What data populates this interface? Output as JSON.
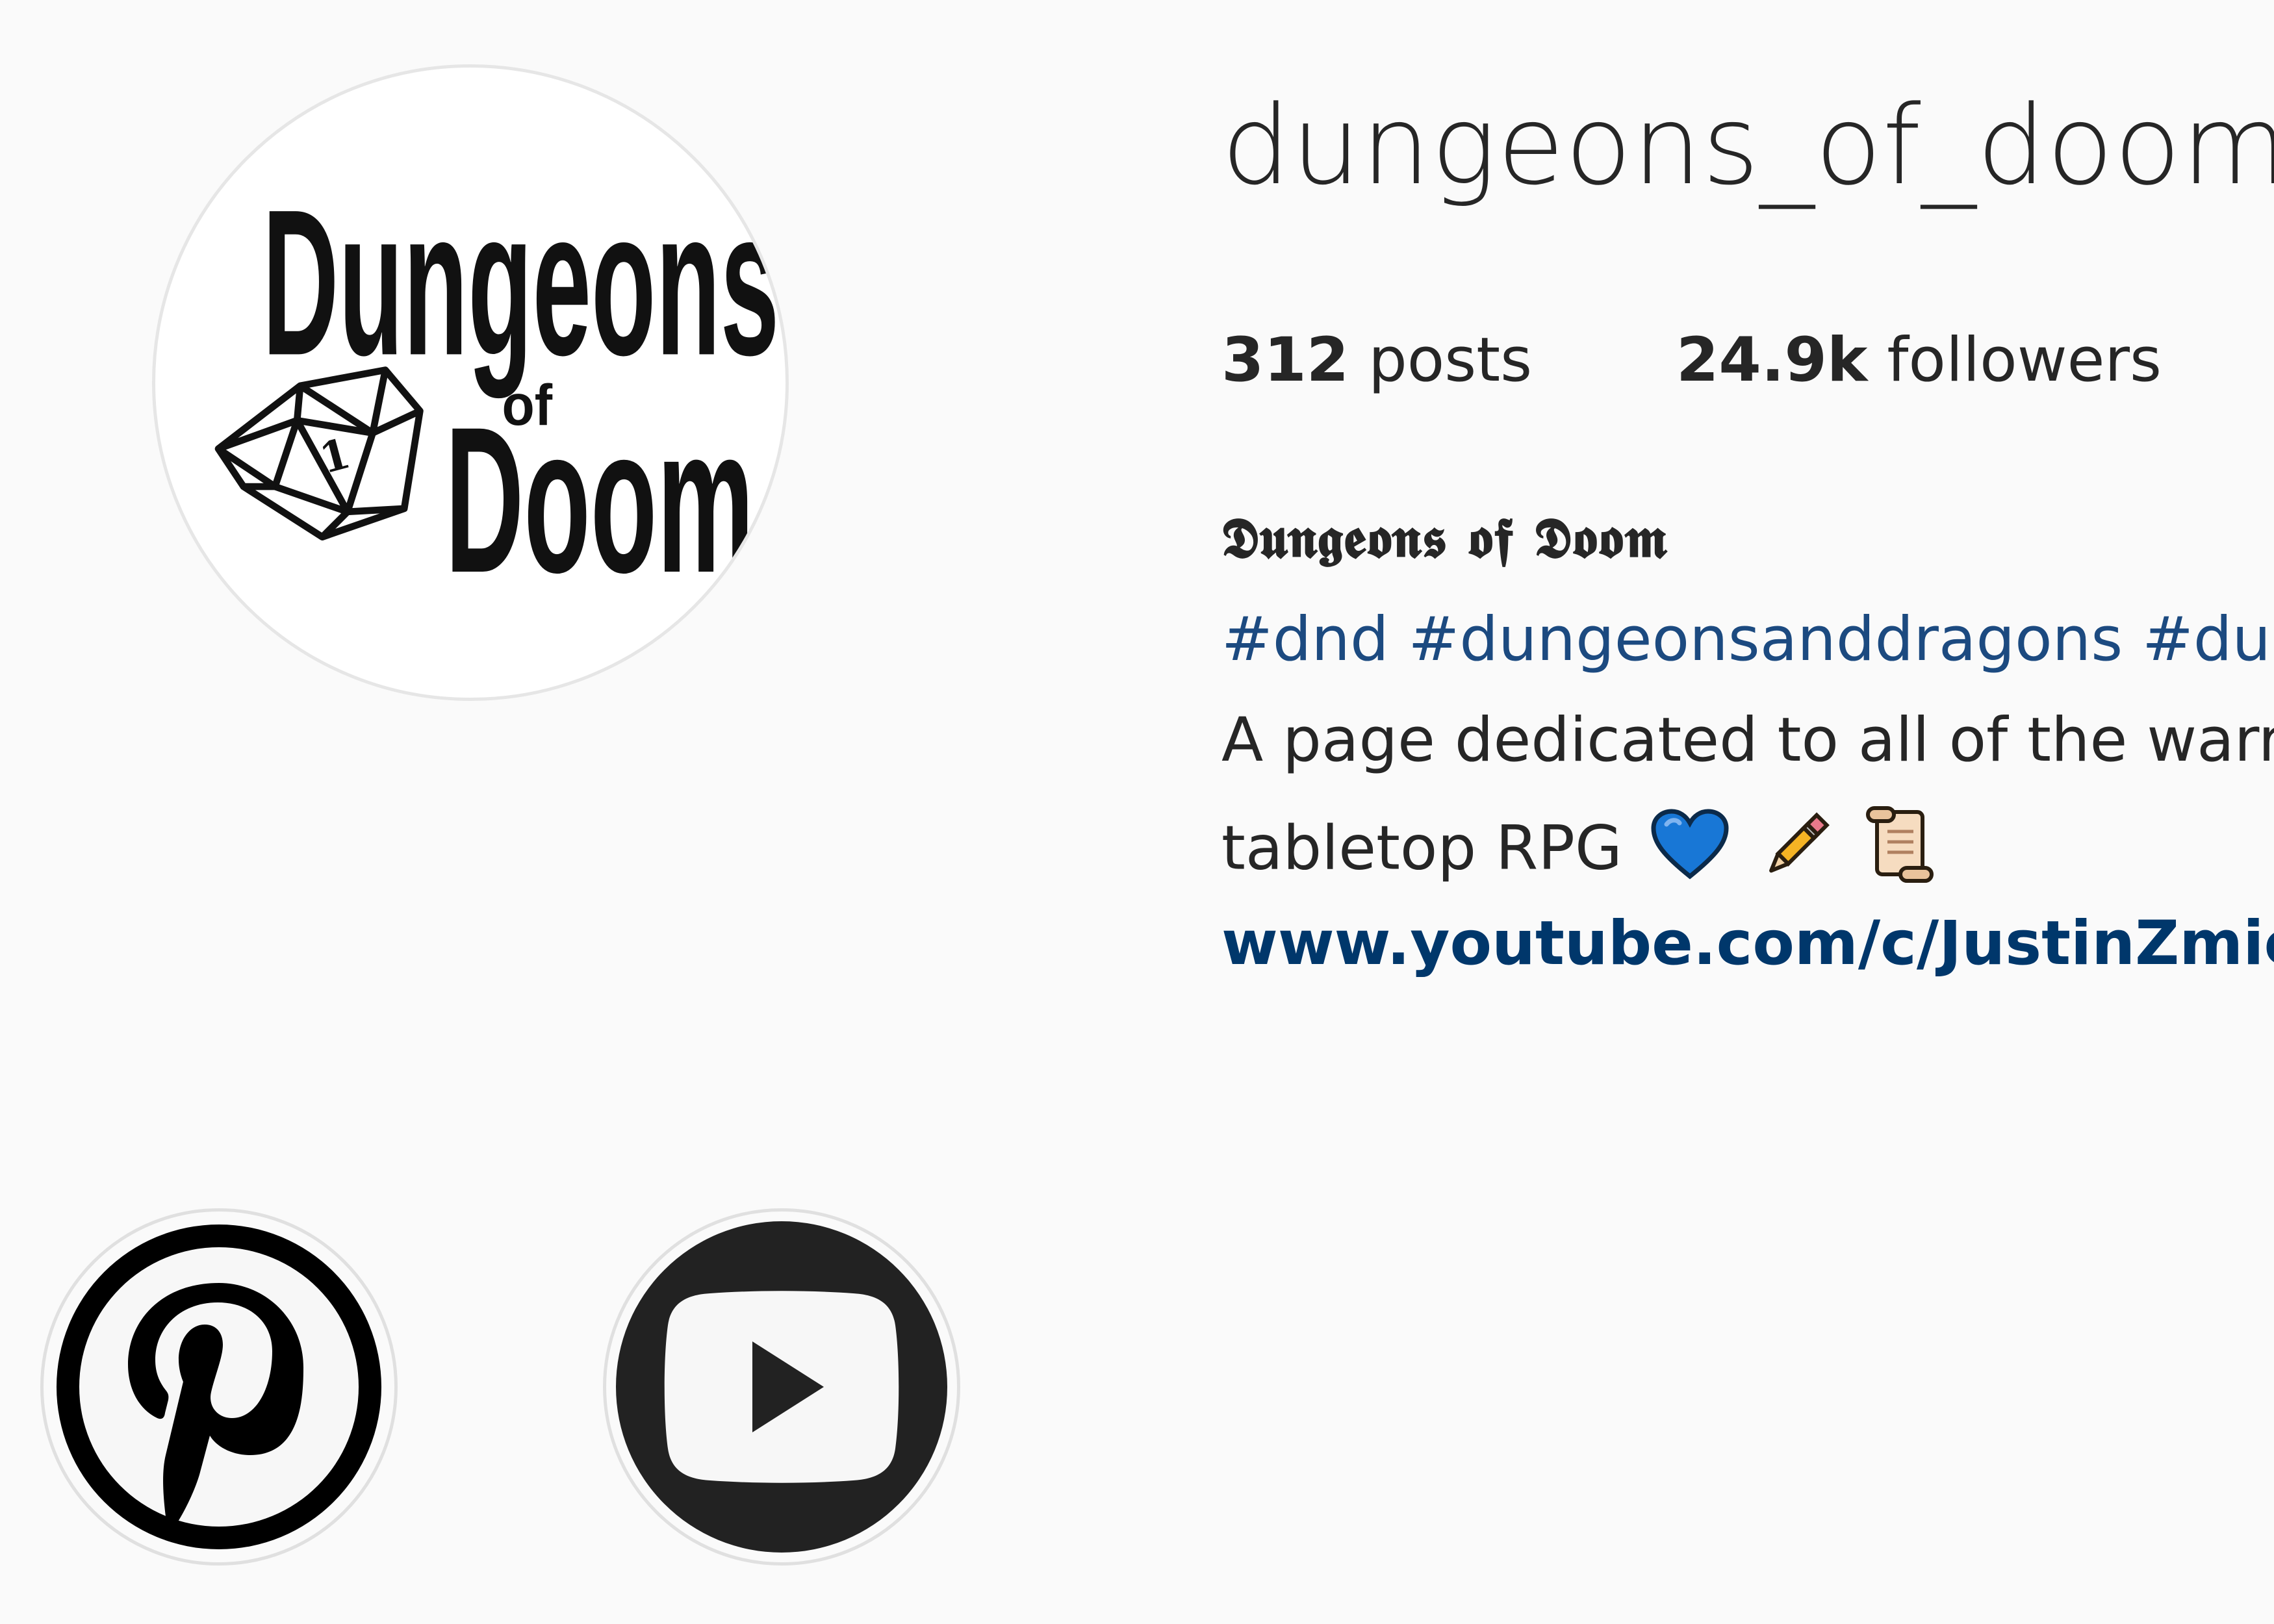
{
  "profile": {
    "username": "dungeons_of_doom",
    "avatar_icon": "dungeons-of-doom-logo-d20-icon",
    "avatar_logo_text": "Dungeons of Doom",
    "stats": {
      "posts_count": "312",
      "posts_label": "posts",
      "followers_count": "24.9k",
      "followers_label": "followers"
    },
    "bio": {
      "name": "𝕯𝖚𝖓𝖌𝖊𝖔𝖓𝖘 𝖔𝖋 𝕯𝖔𝖔𝖒",
      "hashtags": "#dnd #dungeonsanddragons #dun",
      "description_line1": "A page dedicated to all of the warri",
      "description_line2": "tabletop RPG",
      "emojis": [
        "blue-heart-icon",
        "pencil-icon",
        "scroll-icon"
      ],
      "link": "www.youtube.com/c/JustinZmich"
    }
  },
  "highlights": [
    {
      "icon": "pinterest-icon"
    },
    {
      "icon": "youtube-icon"
    }
  ],
  "colors": {
    "background": "#fafafa",
    "text": "#262626",
    "hashtag": "#1c4a80",
    "link": "#00376b",
    "heart": "#1877d6",
    "pencil": "#f5b324"
  }
}
